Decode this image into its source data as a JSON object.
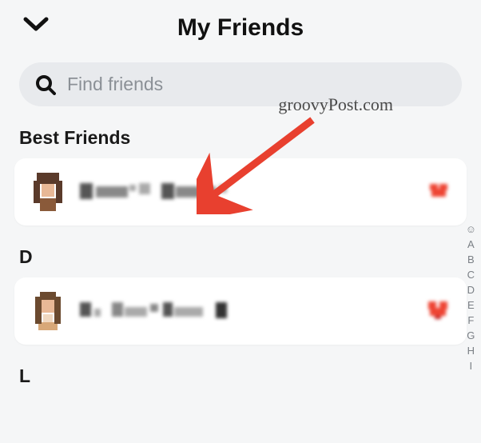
{
  "header": {
    "title": "My Friends"
  },
  "search": {
    "placeholder": "Find friends"
  },
  "sections": {
    "best_friends_label": "Best Friends",
    "d_label": "D",
    "l_label": "L"
  },
  "friends": {
    "best_friend_1": {
      "name": "[redacted]",
      "emoji": "heart"
    },
    "d_friend_1": {
      "name": "[redacted]",
      "emoji": "heart"
    }
  },
  "alpha_index": {
    "smiley": "☺",
    "letters": [
      "A",
      "B",
      "C",
      "D",
      "E",
      "F",
      "G",
      "H",
      "I"
    ]
  },
  "watermark": "groovyPost.com"
}
